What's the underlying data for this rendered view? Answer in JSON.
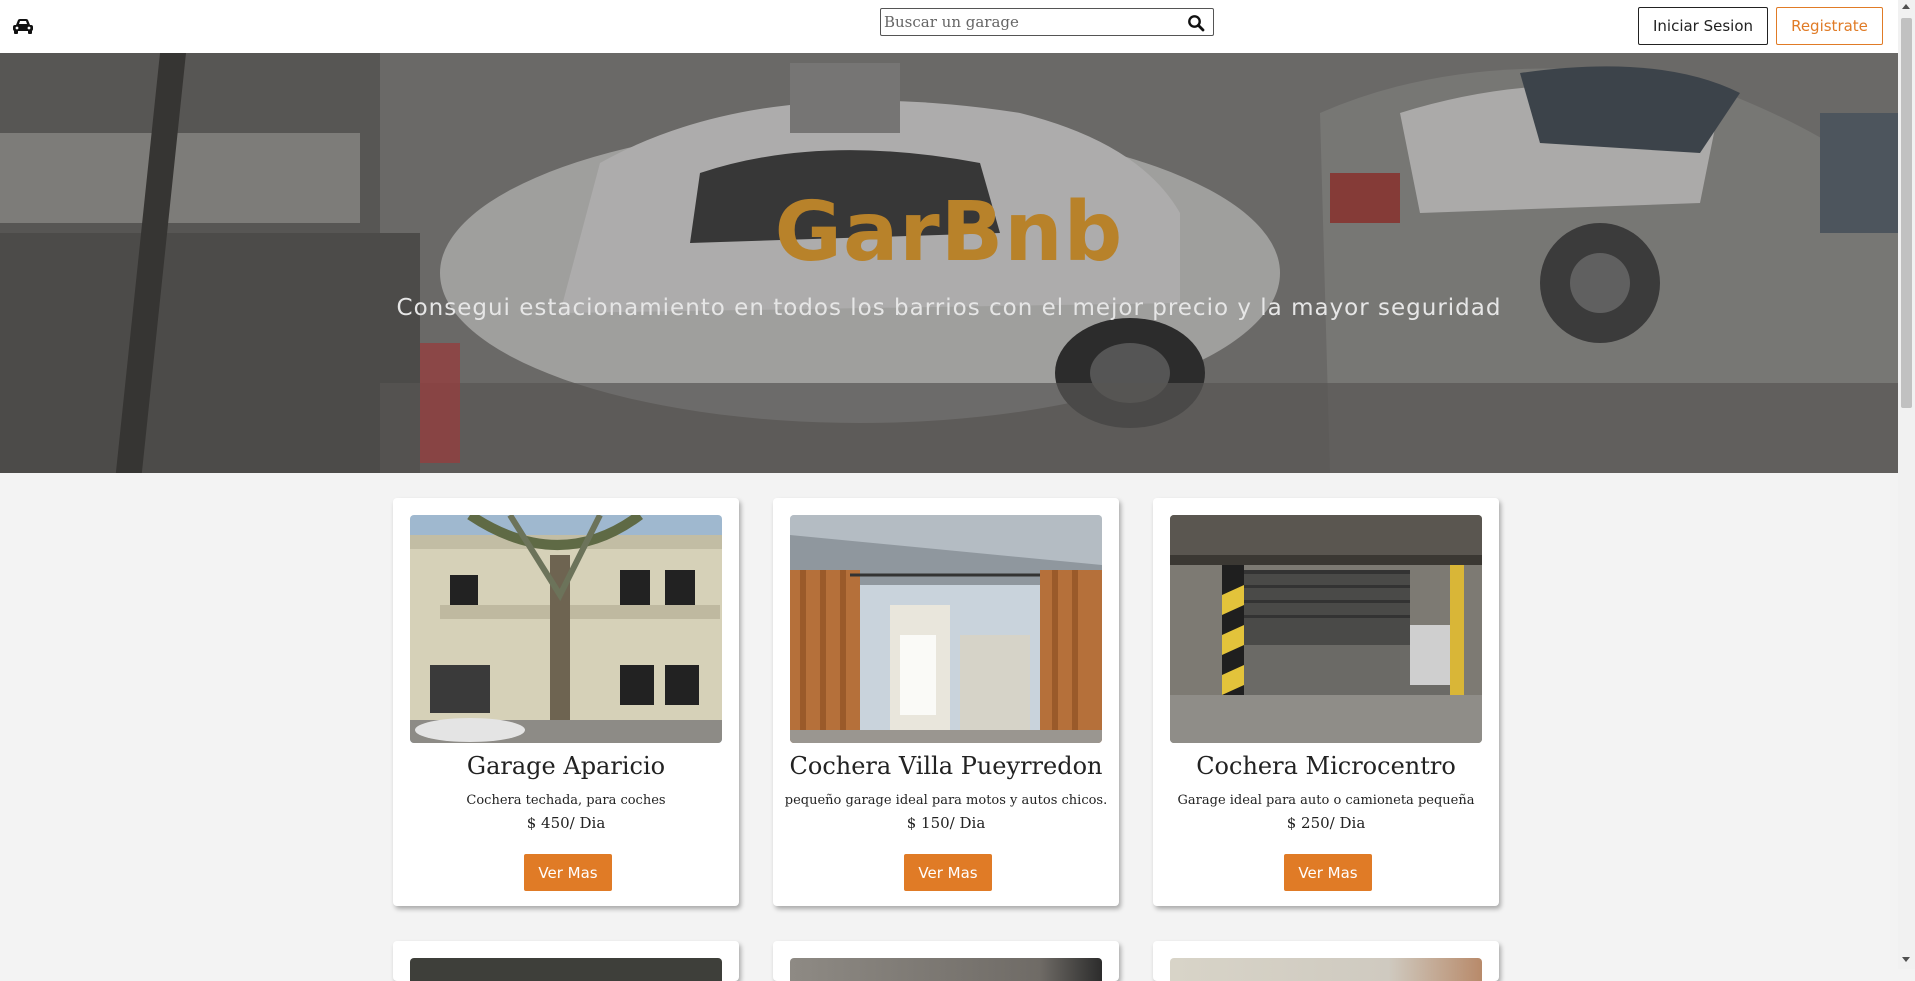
{
  "header": {
    "logo_icon": "car-icon",
    "search": {
      "placeholder": "Buscar un garage",
      "value": "",
      "icon": "search-icon"
    },
    "login_label": "Iniciar Sesion",
    "register_label": "Registrate"
  },
  "hero": {
    "title": "GarBnb",
    "subtitle": "Consegui estacionamiento en todos los barrios con el mejor precio y la mayor seguridad"
  },
  "listings": [
    {
      "title": "Garage Aparicio",
      "description": "Cochera techada, para coches",
      "price": "$ 450/ Dia",
      "button": "Ver Mas"
    },
    {
      "title": "Cochera Villa Pueyrredon",
      "description": "pequeño garage ideal para motos y autos chicos.",
      "price": "$ 150/ Dia",
      "button": "Ver Mas"
    },
    {
      "title": "Cochera Microcentro",
      "description": "Garage ideal para auto o camioneta pequeña",
      "price": "$ 250/ Dia",
      "button": "Ver Mas"
    }
  ],
  "colors": {
    "accent": "#e07b26",
    "hero_title": "#b8822a",
    "background": "#f3f3f3"
  }
}
